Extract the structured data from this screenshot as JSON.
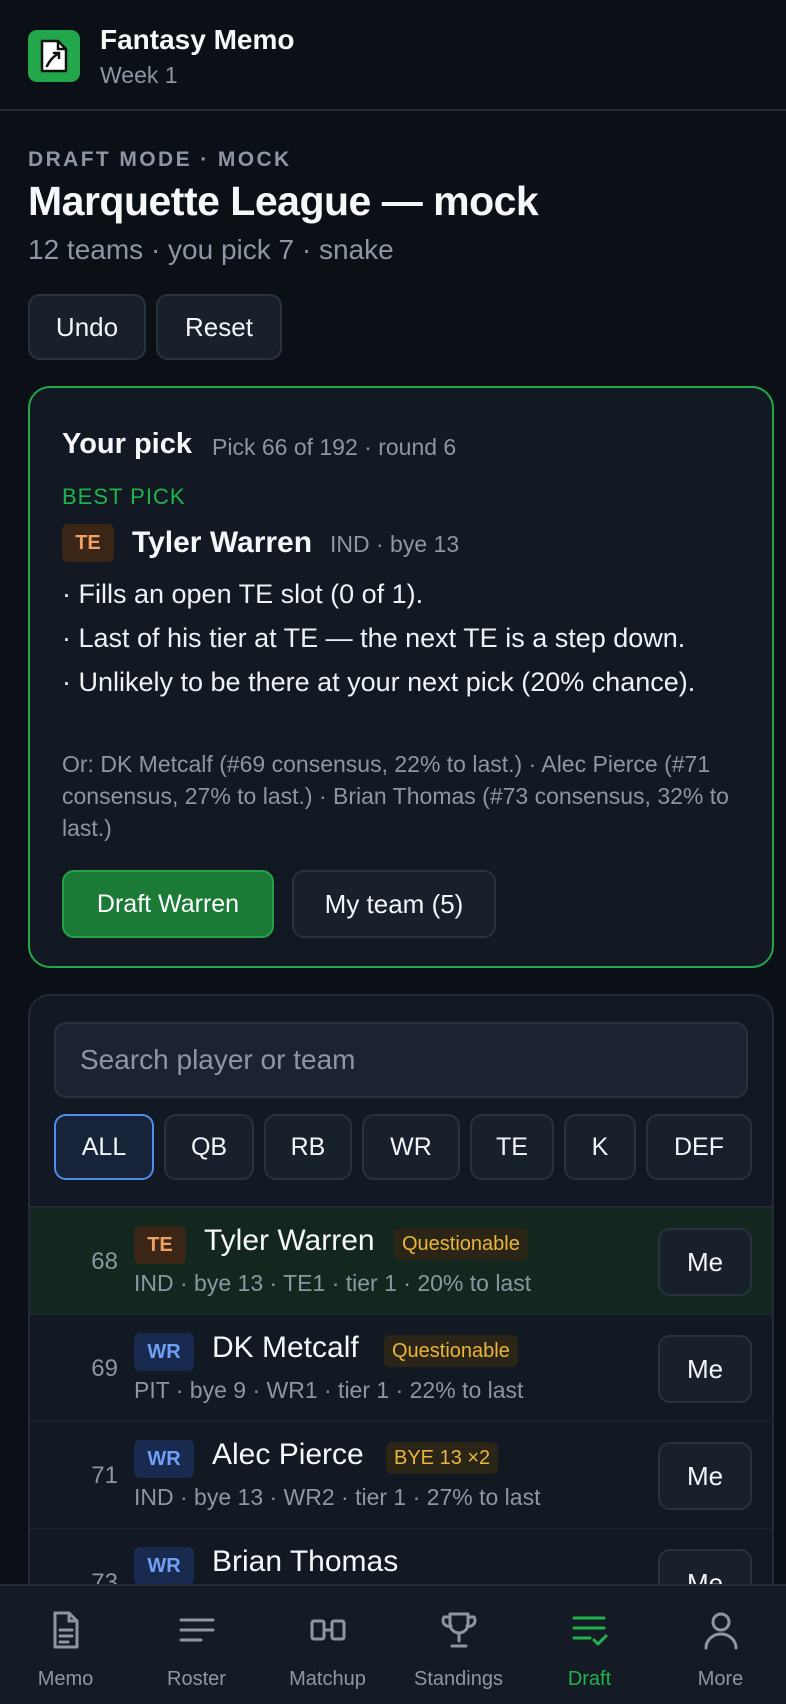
{
  "header": {
    "app_name": "Fantasy Memo",
    "week": "Week 1",
    "accent": "#22a74a"
  },
  "draft": {
    "mode": "DRAFT MODE · MOCK",
    "league": "Marquette League — mock",
    "meta": "12 teams · you pick 7 · snake",
    "undo_label": "Undo",
    "reset_label": "Reset"
  },
  "pick": {
    "title": "Your pick",
    "info": "Pick 66 of 192 · round 6",
    "best_label": "BEST PICK",
    "position": "TE",
    "name": "Tyler Warren",
    "meta": "IND · bye 13",
    "reasons": [
      "· Fills an open TE slot (0 of 1).",
      "· Last of his tier at TE — the next TE is a step down.",
      "· Unlikely to be there at your next pick (20% chance)."
    ],
    "alternatives": "Or: DK Metcalf (#69 consensus, 22% to last.) · Alec Pierce (#71 consensus, 27% to last.) · Brian Thomas (#73 consensus, 32% to last.)",
    "draft_button": "Draft Warren",
    "team_button": "My team (5)"
  },
  "list": {
    "search_placeholder": "Search player or team",
    "filters": [
      "ALL",
      "QB",
      "RB",
      "WR",
      "TE",
      "K",
      "DEF"
    ],
    "active_filter": "ALL",
    "players": [
      {
        "rank": "68",
        "pos": "TE",
        "name": "Tyler Warren",
        "tag": "Questionable",
        "meta": "IND · bye 13 · TE1 · tier 1 · 20% to last",
        "action": "Me"
      },
      {
        "rank": "69",
        "pos": "WR",
        "name": "DK Metcalf",
        "tag": "Questionable",
        "meta": "PIT · bye 9 · WR1 · tier 1 · 22% to last",
        "action": "Me"
      },
      {
        "rank": "71",
        "pos": "WR",
        "name": "Alec Pierce",
        "tag": "BYE 13 ×2",
        "meta": "IND · bye 13 · WR2 · tier 1 · 27% to last",
        "action": "Me"
      },
      {
        "rank": "73",
        "pos": "WR",
        "name": "Brian Thomas",
        "tag": "",
        "meta": "",
        "action": "Me"
      }
    ]
  },
  "tabs": [
    {
      "label": "Memo",
      "icon": "document-icon"
    },
    {
      "label": "Roster",
      "icon": "list-icon"
    },
    {
      "label": "Matchup",
      "icon": "matchup-icon"
    },
    {
      "label": "Standings",
      "icon": "trophy-icon"
    },
    {
      "label": "Draft",
      "icon": "draft-checklist-icon",
      "active": true
    },
    {
      "label": "More",
      "icon": "person-icon"
    }
  ]
}
